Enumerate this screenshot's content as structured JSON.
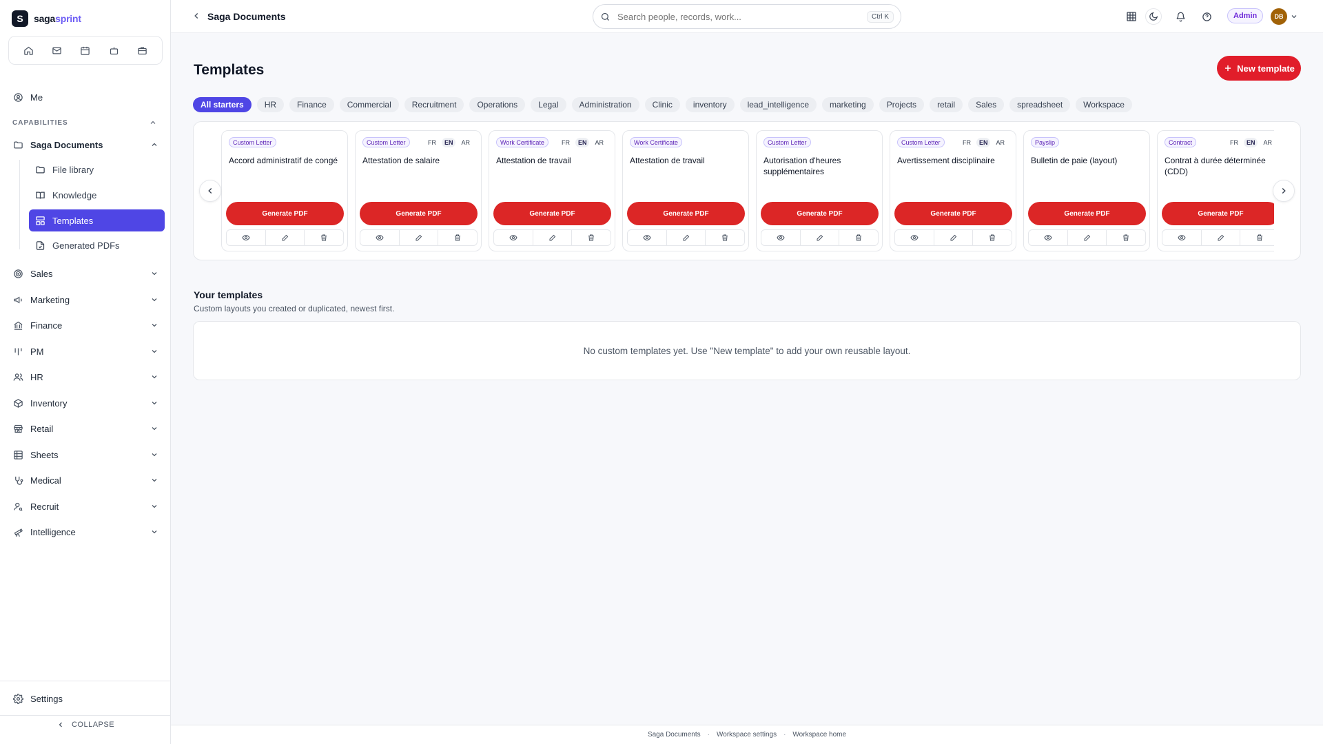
{
  "app": {
    "logo_letter": "S",
    "logo_part1": "saga",
    "logo_part2": "sprint"
  },
  "quick_icons": [
    "home-icon",
    "mail-icon",
    "calendar-icon",
    "bot-icon",
    "briefcase-icon"
  ],
  "sidebar": {
    "me": "Me",
    "capabilities_label": "CAPABILITIES",
    "saga_documents": "Saga Documents",
    "sub_items": [
      {
        "label": "File library",
        "icon": "folder-icon"
      },
      {
        "label": "Knowledge",
        "icon": "book-icon"
      },
      {
        "label": "Templates",
        "icon": "layout-icon",
        "active": true
      },
      {
        "label": "Generated PDFs",
        "icon": "file-check-icon"
      }
    ],
    "groups": [
      {
        "label": "Sales",
        "icon": "target-icon"
      },
      {
        "label": "Marketing",
        "icon": "megaphone-icon"
      },
      {
        "label": "Finance",
        "icon": "bank-icon"
      },
      {
        "label": "PM",
        "icon": "kanban-icon"
      },
      {
        "label": "HR",
        "icon": "users-icon"
      },
      {
        "label": "Inventory",
        "icon": "box-icon"
      },
      {
        "label": "Retail",
        "icon": "store-icon"
      },
      {
        "label": "Sheets",
        "icon": "table-icon"
      },
      {
        "label": "Medical",
        "icon": "stethoscope-icon"
      },
      {
        "label": "Recruit",
        "icon": "user-search-icon"
      },
      {
        "label": "Intelligence",
        "icon": "telescope-icon"
      }
    ],
    "settings": "Settings",
    "collapse": "COLLAPSE"
  },
  "topbar": {
    "breadcrumb": "Saga Documents",
    "search_placeholder": "Search people, records, work...",
    "search_shortcut": "Ctrl K",
    "role_badge": "Admin",
    "avatar_initials": "DB"
  },
  "main": {
    "title": "Templates",
    "new_button": "New template",
    "filters": [
      {
        "label": "All starters",
        "active": true
      },
      {
        "label": "HR"
      },
      {
        "label": "Finance"
      },
      {
        "label": "Commercial"
      },
      {
        "label": "Recruitment"
      },
      {
        "label": "Operations"
      },
      {
        "label": "Legal"
      },
      {
        "label": "Administration"
      },
      {
        "label": "Clinic"
      },
      {
        "label": "inventory"
      },
      {
        "label": "lead_intelligence"
      },
      {
        "label": "marketing"
      },
      {
        "label": "Projects"
      },
      {
        "label": "retail"
      },
      {
        "label": "Sales"
      },
      {
        "label": "spreadsheet"
      },
      {
        "label": "Workspace"
      }
    ],
    "generate_label": "Generate PDF",
    "lang_labels": [
      "FR",
      "EN",
      "AR"
    ],
    "cards": [
      {
        "tag": "Custom Letter",
        "title": "Accord administratif de congé",
        "langs": false
      },
      {
        "tag": "Custom Letter",
        "title": "Attestation de salaire",
        "langs": true
      },
      {
        "tag": "Work Certificate",
        "title": "Attestation de travail",
        "langs": true
      },
      {
        "tag": "Work Certificate",
        "title": "Attestation de travail",
        "langs": false
      },
      {
        "tag": "Custom Letter",
        "title": "Autorisation d'heures supplémentaires",
        "langs": false
      },
      {
        "tag": "Custom Letter",
        "title": "Avertissement disciplinaire",
        "langs": true
      },
      {
        "tag": "Payslip",
        "title": "Bulletin de paie (layout)",
        "langs": false
      },
      {
        "tag": "Contract",
        "title": "Contrat à durée déterminée (CDD)",
        "langs": true
      }
    ],
    "your_templates_title": "Your templates",
    "your_templates_sub": "Custom layouts you created or duplicated, newest first.",
    "empty_message": "No custom templates yet. Use \"New template\" to add your own reusable layout."
  },
  "footer": {
    "links": [
      "Saga Documents",
      "Workspace settings",
      "Workspace home"
    ]
  },
  "colors": {
    "accent": "#4f46e5",
    "primary_red": "#e11d2a",
    "tag_purple": "#5b21b6"
  }
}
